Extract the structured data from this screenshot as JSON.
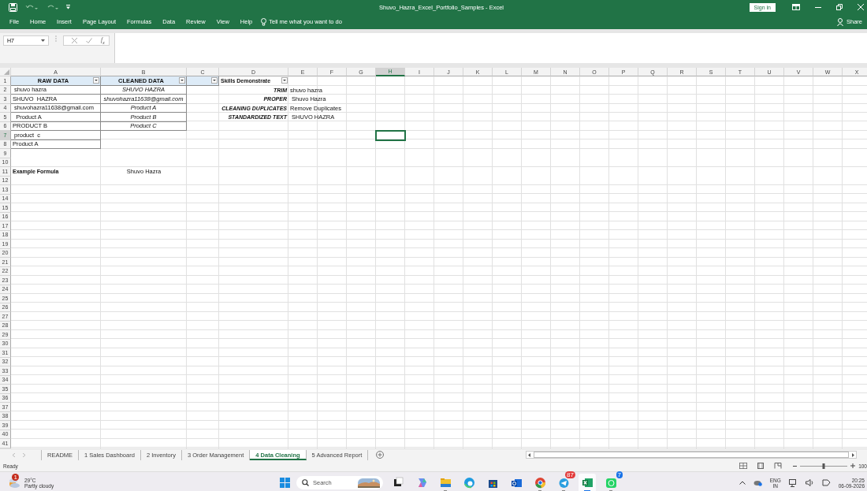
{
  "window": {
    "title": "Shuvo_Hazra_Excel_Portfolio_Samples  -  Excel",
    "sign_in": "Sign in",
    "share": "Share"
  },
  "ribbon_tabs": [
    "File",
    "Home",
    "Insert",
    "Page Layout",
    "Formulas",
    "Data",
    "Review",
    "View",
    "Help"
  ],
  "tell_me": "Tell me what you want to do",
  "name_box": "H7",
  "fx": "f$_{x}$",
  "column_headers": [
    {
      "label": "A",
      "selected": false
    },
    {
      "label": "B",
      "selected": false
    },
    {
      "label": "C",
      "selected": false
    },
    {
      "label": "D",
      "selected": false
    },
    {
      "label": "E",
      "selected": false
    },
    {
      "label": "F",
      "selected": false
    },
    {
      "label": "G",
      "selected": false
    },
    {
      "label": "H",
      "selected": true
    },
    {
      "label": "I",
      "selected": false
    },
    {
      "label": "J",
      "selected": false
    },
    {
      "label": "K",
      "selected": false
    },
    {
      "label": "L",
      "selected": false
    },
    {
      "label": "M",
      "selected": false
    },
    {
      "label": "N",
      "selected": false
    },
    {
      "label": "O",
      "selected": false
    },
    {
      "label": "P",
      "selected": false
    },
    {
      "label": "Q",
      "selected": false
    },
    {
      "label": "R",
      "selected": false
    },
    {
      "label": "S",
      "selected": false
    },
    {
      "label": "T",
      "selected": false
    },
    {
      "label": "U",
      "selected": false
    },
    {
      "label": "V",
      "selected": false
    },
    {
      "label": "W",
      "selected": false
    },
    {
      "label": "X",
      "selected": false
    }
  ],
  "rows": [
    {
      "number": "1",
      "selected": false,
      "cells": {
        "A": {
          "kind": "header",
          "text": "RAW DATA",
          "filter": true,
          "bordered": true
        },
        "B": {
          "kind": "header",
          "text": "CLEANED DATA",
          "filter": true,
          "bordered": true
        },
        "C": {
          "kind": "header",
          "filter": true,
          "bordered": true
        },
        "D": {
          "kind": "bold",
          "text": "Skills Demonstrate",
          "filter": true
        }
      }
    },
    {
      "number": "2",
      "selected": false,
      "cells": {
        "A": {
          "kind": "plain",
          "text": " shuvo hazra",
          "bordered": true
        },
        "B": {
          "kind": "italic",
          "text": "SHUVO HAZRA",
          "bordered": true
        },
        "D": {
          "kind": "skill",
          "text": "TRIM"
        },
        "E": {
          "kind": "plain",
          "text": "shuvo hazra"
        }
      }
    },
    {
      "number": "3",
      "selected": false,
      "cells": {
        "A": {
          "kind": "plain",
          "text": "SHUVO  HAZRA",
          "bordered": true
        },
        "B": {
          "kind": "italic",
          "text": "shuvohazra11638@gmail.com",
          "bordered": true
        },
        "D": {
          "kind": "skill",
          "text": "PROPER"
        },
        "E": {
          "kind": "plain",
          "text": " Shuvo Hazra"
        }
      }
    },
    {
      "number": "4",
      "selected": false,
      "cells": {
        "A": {
          "kind": "plain",
          "text": " shuvohazra11638@gmail.com",
          "bordered": true
        },
        "B": {
          "kind": "italic",
          "text": "Product A",
          "bordered": true
        },
        "D": {
          "kind": "skill",
          "text": "CLEANING DUPLICATES"
        },
        "E": {
          "kind": "plain",
          "text": "Remove Duplicates"
        }
      }
    },
    {
      "number": "5",
      "selected": false,
      "cells": {
        "A": {
          "kind": "plain",
          "text": "  Product A",
          "bordered": true
        },
        "B": {
          "kind": "italic",
          "text": "Product B",
          "bordered": true
        },
        "D": {
          "kind": "skill",
          "text": "STANDARDIZED TEXT"
        },
        "E": {
          "kind": "plain",
          "text": " SHUVO HAZRA"
        }
      }
    },
    {
      "number": "6",
      "selected": false,
      "cells": {
        "A": {
          "kind": "plain",
          "text": "PRODUCT B",
          "bordered": true
        },
        "B": {
          "kind": "italic",
          "text": "Product C",
          "bordered": true
        }
      }
    },
    {
      "number": "7",
      "selected": true,
      "cells": {
        "A": {
          "kind": "plain",
          "text": " product  c",
          "bordered": true
        },
        "H": {
          "selected": true
        }
      }
    },
    {
      "number": "8",
      "selected": false,
      "cells": {
        "A": {
          "kind": "plain",
          "text": "Product A",
          "bordered": true
        }
      }
    },
    {
      "number": "9",
      "selected": false,
      "cells": {}
    },
    {
      "number": "10",
      "selected": false,
      "cells": {}
    },
    {
      "number": "11",
      "selected": false,
      "cells": {
        "A": {
          "kind": "bold",
          "text": "Example Formula"
        },
        "B": {
          "kind": "center",
          "text": "Shuvo Hazra"
        }
      }
    },
    {
      "number": "12",
      "selected": false,
      "cells": {}
    },
    {
      "number": "13",
      "selected": false,
      "cells": {}
    },
    {
      "number": "14",
      "selected": false,
      "cells": {}
    },
    {
      "number": "15",
      "selected": false,
      "cells": {}
    },
    {
      "number": "16",
      "selected": false,
      "cells": {}
    },
    {
      "number": "17",
      "selected": false,
      "cells": {}
    },
    {
      "number": "18",
      "selected": false,
      "cells": {}
    },
    {
      "number": "19",
      "selected": false,
      "cells": {}
    },
    {
      "number": "20",
      "selected": false,
      "cells": {}
    },
    {
      "number": "21",
      "selected": false,
      "cells": {}
    },
    {
      "number": "22",
      "selected": false,
      "cells": {}
    },
    {
      "number": "23",
      "selected": false,
      "cells": {}
    },
    {
      "number": "24",
      "selected": false,
      "cells": {}
    },
    {
      "number": "25",
      "selected": false,
      "cells": {}
    },
    {
      "number": "26",
      "selected": false,
      "cells": {}
    },
    {
      "number": "27",
      "selected": false,
      "cells": {}
    },
    {
      "number": "28",
      "selected": false,
      "cells": {}
    },
    {
      "number": "29",
      "selected": false,
      "cells": {}
    },
    {
      "number": "30",
      "selected": false,
      "cells": {}
    },
    {
      "number": "31",
      "selected": false,
      "cells": {}
    },
    {
      "number": "32",
      "selected": false,
      "cells": {}
    },
    {
      "number": "33",
      "selected": false,
      "cells": {}
    },
    {
      "number": "34",
      "selected": false,
      "cells": {}
    },
    {
      "number": "35",
      "selected": false,
      "cells": {}
    },
    {
      "number": "36",
      "selected": false,
      "cells": {}
    },
    {
      "number": "37",
      "selected": false,
      "cells": {}
    },
    {
      "number": "38",
      "selected": false,
      "cells": {}
    },
    {
      "number": "39",
      "selected": false,
      "cells": {}
    },
    {
      "number": "40",
      "selected": false,
      "cells": {}
    },
    {
      "number": "41",
      "selected": false,
      "cells": {}
    }
  ],
  "sheet_tabs": [
    {
      "label": "README",
      "selected": false
    },
    {
      "label": "1 Sales Dashboard",
      "selected": false
    },
    {
      "label": "2 Inventory",
      "selected": false
    },
    {
      "label": "3 Order Management",
      "selected": false
    },
    {
      "label": "4 Data Cleaning",
      "selected": true
    },
    {
      "label": "5 Advanced Report",
      "selected": false
    }
  ],
  "status_bar": {
    "status": "Ready",
    "zoom": {
      "level": 0.5,
      "reading": "100"
    }
  },
  "taskbar": {
    "weather": {
      "temperature": "29°C",
      "condition": "Partly cloudy",
      "badge": "1"
    },
    "search_placeholder": "Search",
    "apps": [
      {
        "kind": "taskview",
        "running": false,
        "active": false
      },
      {
        "kind": "copilot",
        "running": false,
        "active": false
      },
      {
        "kind": "explorer",
        "running": true,
        "active": false
      },
      {
        "kind": "edge",
        "running": false,
        "active": false
      },
      {
        "kind": "store",
        "running": false,
        "active": false
      },
      {
        "kind": "outlook",
        "running": false,
        "active": false
      },
      {
        "kind": "chrome",
        "running": true,
        "active": false
      },
      {
        "kind": "telegram",
        "running": true,
        "active": false,
        "badge": "87"
      },
      {
        "kind": "excel",
        "running": true,
        "active": true
      },
      {
        "kind": "whatsapp",
        "running": true,
        "active": false,
        "badge": "7"
      }
    ],
    "language": "ENG",
    "region": "IN",
    "time": "20:25",
    "date": "06-09-2026"
  }
}
